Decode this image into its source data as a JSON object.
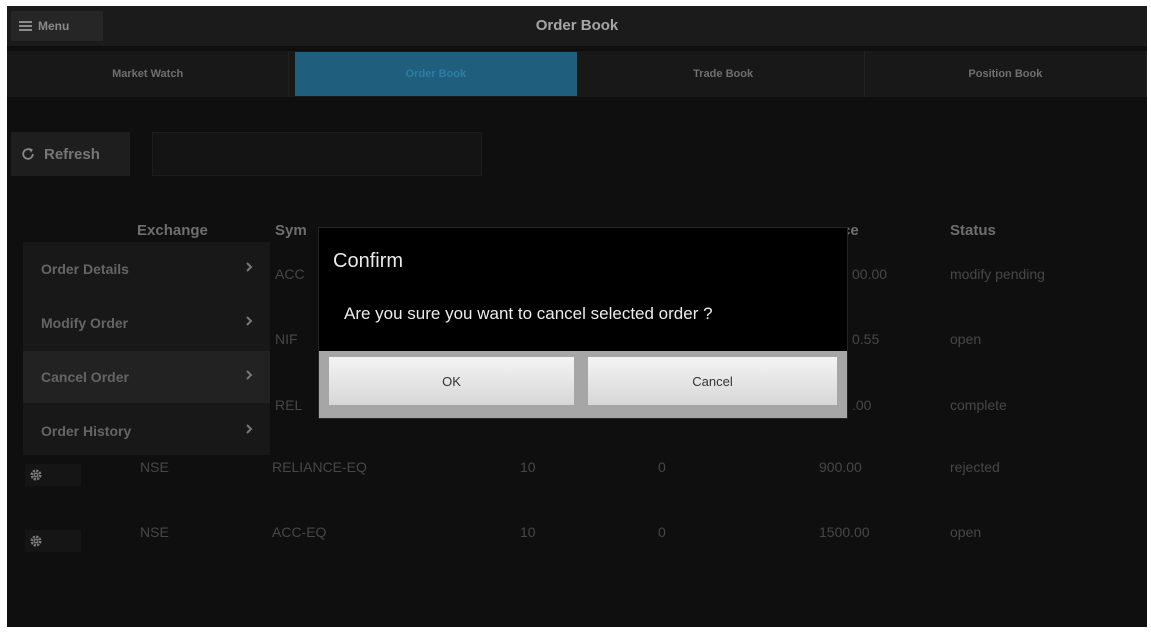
{
  "header": {
    "menu_label": "Menu",
    "title": "Order Book"
  },
  "tabs": [
    "Market Watch",
    "Order Book",
    "Trade Book",
    "Position Book"
  ],
  "toolbar": {
    "refresh_label": "Refresh",
    "search_value": ""
  },
  "table": {
    "columns": {
      "exchange": "Exchange",
      "symbol": "Sym",
      "price": "ce",
      "status": "Status"
    },
    "rows": [
      {
        "symbol": "ACC",
        "price": "00.00",
        "status": "modify pending"
      },
      {
        "symbol": "NIF",
        "price": "0.55",
        "status": "open"
      },
      {
        "symbol": "REL",
        "price": ".00",
        "status": "complete"
      },
      {
        "exchange": "NSE",
        "symbol": "RELIANCE-EQ",
        "qty": "10",
        "filled": "0",
        "price": "900.00",
        "status": "rejected"
      },
      {
        "exchange": "NSE",
        "symbol": "ACC-EQ",
        "qty": "10",
        "filled": "0",
        "price": "1500.00",
        "status": "open"
      }
    ]
  },
  "context_menu": [
    "Order Details",
    "Modify Order",
    "Cancel Order",
    "Order History"
  ],
  "dialog": {
    "title": "Confirm",
    "message": "Are you sure you want to  cancel selected order ?",
    "ok_label": "OK",
    "cancel_label": "Cancel"
  },
  "colors": {
    "background": "#0f0f0f",
    "active_tab": "#1f5e7d",
    "dialog_bg": "#000000",
    "dialog_buttonbar": "#a6a6a6"
  },
  "icons": {
    "menu": "hamburger-icon",
    "refresh": "refresh-icon",
    "row_action": "gear-icon",
    "menu_item": "chevron-right-icon"
  }
}
